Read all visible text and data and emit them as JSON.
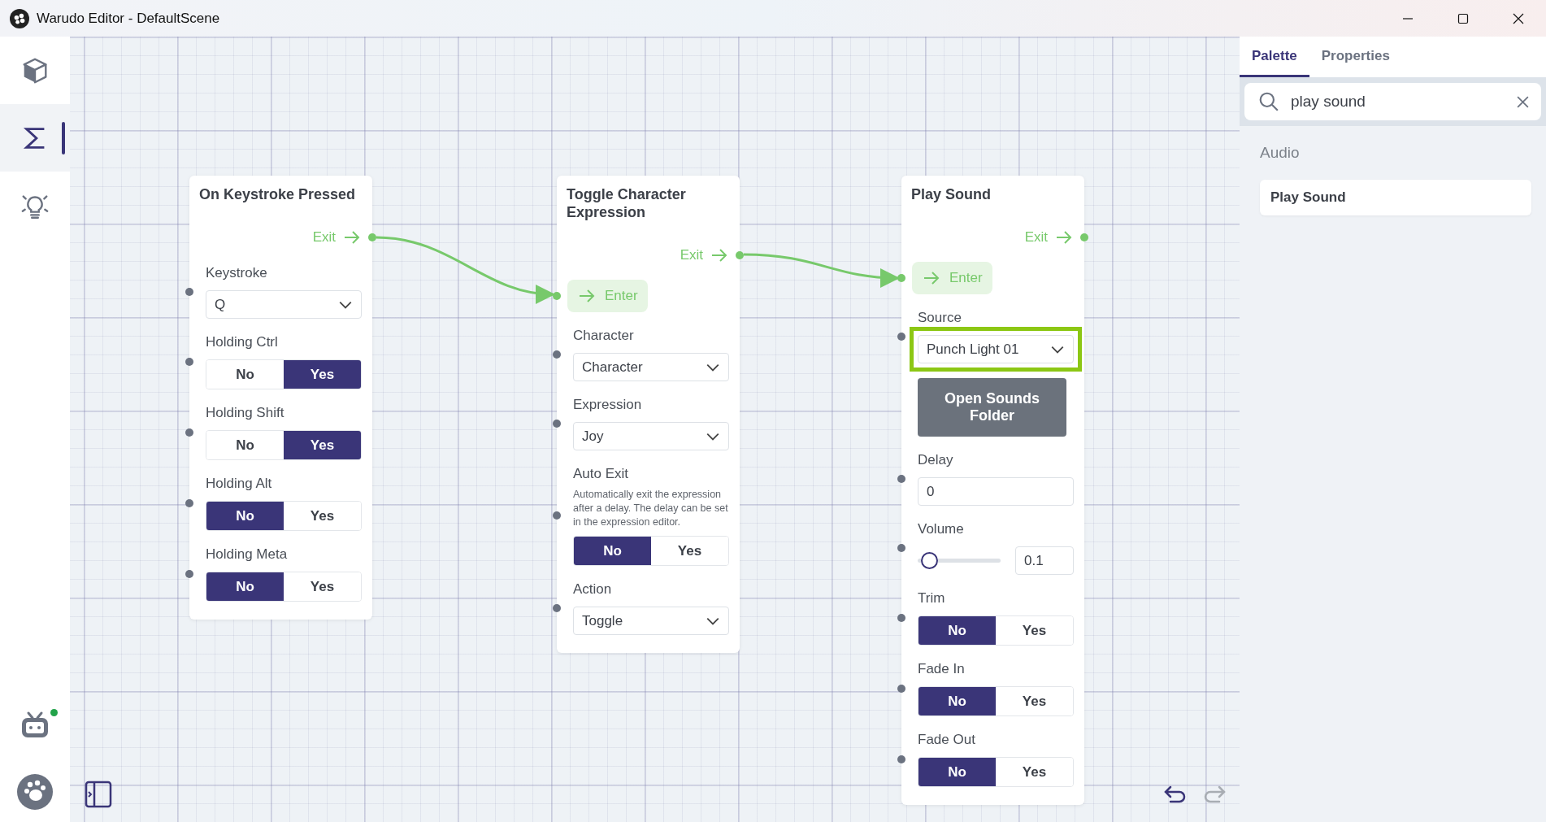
{
  "window": {
    "title": "Warudo Editor - DefaultScene"
  },
  "sidebar": {
    "items": [
      {
        "kind": "cube",
        "selected": false
      },
      {
        "kind": "sigma",
        "selected": true
      },
      {
        "kind": "bulb",
        "selected": false
      }
    ],
    "bot": {
      "online": true
    }
  },
  "nodes": [
    {
      "title": "On Keystroke Pressed",
      "exit": "Exit",
      "fields": [
        {
          "kind": "dropdown",
          "label": "Keystroke",
          "value": "Q"
        },
        {
          "kind": "toggle",
          "label": "Holding Ctrl",
          "options": [
            {
              "label": "No",
              "selected": false
            },
            {
              "label": "Yes",
              "selected": true
            }
          ]
        },
        {
          "kind": "toggle",
          "label": "Holding Shift",
          "options": [
            {
              "label": "No",
              "selected": false
            },
            {
              "label": "Yes",
              "selected": true
            }
          ]
        },
        {
          "kind": "toggle",
          "label": "Holding Alt",
          "options": [
            {
              "label": "No",
              "selected": true
            },
            {
              "label": "Yes",
              "selected": false
            }
          ]
        },
        {
          "kind": "toggle",
          "label": "Holding Meta",
          "options": [
            {
              "label": "No",
              "selected": true
            },
            {
              "label": "Yes",
              "selected": false
            }
          ]
        }
      ]
    },
    {
      "title": "Toggle Character Expression",
      "exit": "Exit",
      "enter": "Enter",
      "fields": [
        {
          "kind": "dropdown",
          "label": "Character",
          "value": "Character"
        },
        {
          "kind": "dropdown",
          "label": "Expression",
          "value": "Joy"
        },
        {
          "kind": "toggle",
          "label": "Auto Exit",
          "description": "Automatically exit the expression after a delay. The delay can be set in the expression editor.",
          "options": [
            {
              "label": "No",
              "selected": true
            },
            {
              "label": "Yes",
              "selected": false
            }
          ]
        },
        {
          "kind": "dropdown",
          "label": "Action",
          "value": "Toggle"
        }
      ]
    },
    {
      "title": "Play Sound",
      "exit": "Exit",
      "enter": "Enter",
      "fields": [
        {
          "kind": "dropdown",
          "label": "Source",
          "value": "Punch Light 01",
          "highlighted": true
        },
        {
          "kind": "button",
          "label": "Open Sounds Folder"
        },
        {
          "kind": "number",
          "label": "Delay",
          "value": "0"
        },
        {
          "kind": "slider",
          "label": "Volume",
          "level": 0.05,
          "value": "0.1"
        },
        {
          "kind": "toggle",
          "label": "Trim",
          "options": [
            {
              "label": "No",
              "selected": true
            },
            {
              "label": "Yes",
              "selected": false
            }
          ]
        },
        {
          "kind": "toggle",
          "label": "Fade In",
          "options": [
            {
              "label": "No",
              "selected": true
            },
            {
              "label": "Yes",
              "selected": false
            }
          ]
        },
        {
          "kind": "toggle",
          "label": "Fade Out",
          "options": [
            {
              "label": "No",
              "selected": true
            },
            {
              "label": "Yes",
              "selected": false
            }
          ]
        }
      ]
    }
  ],
  "panel": {
    "tabs": [
      {
        "label": "Palette",
        "selected": true
      },
      {
        "label": "Properties",
        "selected": false
      }
    ],
    "search": {
      "value": "play sound"
    },
    "category": "Audio",
    "items": [
      "Play Sound"
    ]
  }
}
